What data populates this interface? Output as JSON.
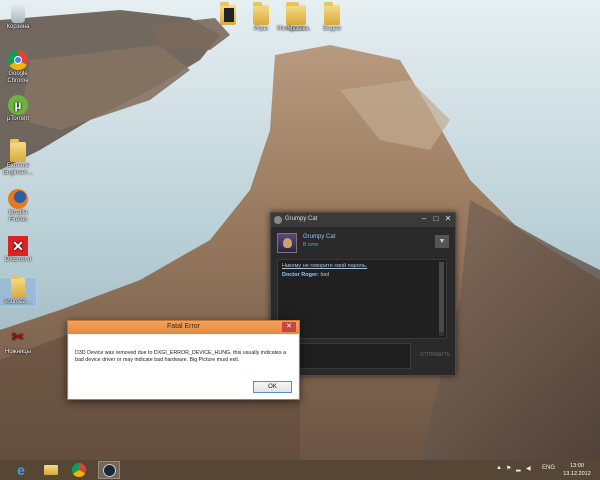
{
  "desktop": {
    "left_icons": [
      {
        "label": "Корзина",
        "icon": "recycle-bin-icon"
      },
      {
        "label": "Google Chrome",
        "icon": "chrome-icon"
      },
      {
        "label": "µTorrent",
        "icon": "utorrent-icon"
      },
      {
        "label": "Extreme Engineer…",
        "icon": "folder-icon"
      },
      {
        "label": "Mozilla Firefox",
        "icon": "firefox-icon"
      },
      {
        "label": "DXError.d",
        "icon": "error-app-icon"
      },
      {
        "label": "source2…",
        "icon": "folder-icon"
      },
      {
        "label": "Ножницы",
        "icon": "scissors-icon"
      }
    ],
    "top_icons": [
      {
        "label": "",
        "icon": "dark-folder-icon"
      },
      {
        "label": "Игры",
        "icon": "folder-icon"
      },
      {
        "label": "Изображе…",
        "icon": "folder-icon"
      },
      {
        "label": "Музыка",
        "icon": "folder-icon"
      },
      {
        "label": "Видео",
        "icon": "folder-icon"
      }
    ]
  },
  "chat_window": {
    "title": "Grumpy Cat",
    "user_name": "Grumpy Cat",
    "user_status": "В сети",
    "messages": [
      {
        "text": "Никому не говорите свой пароль."
      },
      {
        "sender": "Doctor Roger:",
        "text": " lool"
      }
    ],
    "send_label": "ОТПРАВИТЬ"
  },
  "error_dialog": {
    "title": "Fatal Error",
    "message": "D3D Device was removed due to DXGI_ERROR_DEVICE_HUNG, this usually indicates a bad device driver or may indicate bad hardware.  Big Picture must exit.",
    "ok_label": "OK"
  },
  "taskbar": {
    "pinned": [
      {
        "icon": "ie-icon"
      },
      {
        "icon": "file-explorer-icon"
      },
      {
        "icon": "chrome-icon"
      },
      {
        "icon": "steam-icon"
      }
    ],
    "language": "ENG",
    "time": "13:00",
    "date": "13.12.2012"
  },
  "colors": {
    "taskbar": "#503e2a",
    "dialog_title": "#e58a3e",
    "chat_bg": "#2a2a2a",
    "link_blue": "#8cc8f0"
  }
}
